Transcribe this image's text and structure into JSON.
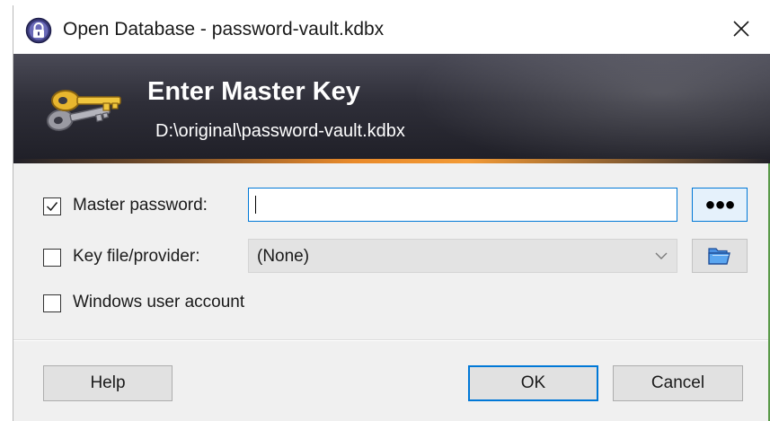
{
  "window": {
    "title": "Open Database - password-vault.kdbx",
    "app_icon": "keepass-lock-icon",
    "close_icon": "close-icon"
  },
  "banner": {
    "title": "Enter Master Key",
    "path": "D:\\original\\password-vault.kdbx",
    "icon": "key-icon"
  },
  "form": {
    "master_password": {
      "label": "Master password:",
      "checked": true,
      "value": "",
      "reveal_button_label": "●●●"
    },
    "key_file": {
      "label": "Key file/provider:",
      "checked": false,
      "selected": "(None)",
      "browse_icon": "folder-open-icon"
    },
    "windows_account": {
      "label": "Windows user account",
      "checked": false
    }
  },
  "buttons": {
    "help": "Help",
    "ok": "OK",
    "cancel": "Cancel"
  },
  "colors": {
    "accent": "#0078d7",
    "banner_dark": "#1f1f27",
    "banner_accent": "#e98a2a"
  }
}
